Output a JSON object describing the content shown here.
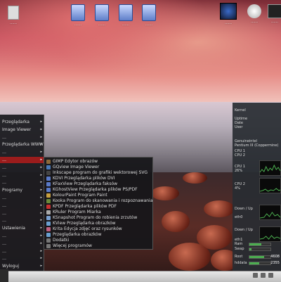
{
  "desktop_icons": [
    {
      "name": "file-icon-top-left",
      "label": "……"
    },
    {
      "name": "folder-1",
      "label": "……"
    },
    {
      "name": "folder-2",
      "label": "……"
    },
    {
      "name": "folder-3",
      "label": "……"
    },
    {
      "name": "folder-4",
      "label": "……"
    },
    {
      "name": "app-icon-1",
      "label": "……"
    },
    {
      "name": "app-icon-2",
      "label": "……"
    },
    {
      "name": "app-icon-3",
      "label": "……"
    }
  ],
  "monitor": {
    "kernel_label": "Kernel",
    "uptime_label": "Uptime",
    "date_label": "Date",
    "user_label": "User",
    "cpu_model_label": "Genuineintel",
    "cpu_model_value": "Pentium III (Coppermine)",
    "cpu1_label": "CPU 1",
    "cpu2_label": "CPU 2",
    "cpu1_pct": "26%",
    "cpu2_pct": "4%",
    "net_label": "Down / Up",
    "if1": "eth0",
    "if2": "eth1",
    "ram_label": "Ram",
    "swap_label": "Swap",
    "root_label": "Root",
    "hdd_label": "hddata",
    "ram_value": "",
    "swap_value": "",
    "root_value": "4608",
    "hdd_value": "2355",
    "ram_fill": 0.55,
    "swap_fill": 0.1,
    "root_fill": 0.7,
    "hdd_fill": 0.45
  },
  "left_menu": [
    {
      "label": "Przeglądarka"
    },
    {
      "label": "Image Viewer"
    },
    {
      "label": "…"
    },
    {
      "label": "Przeglądarka WWW"
    },
    {
      "label": "…"
    },
    {
      "label": "…",
      "active": true
    },
    {
      "label": "…"
    },
    {
      "label": "…"
    },
    {
      "label": "…"
    },
    {
      "label": "Programy"
    },
    {
      "label": "…"
    },
    {
      "label": "…"
    },
    {
      "label": "…"
    },
    {
      "label": "…"
    },
    {
      "label": "Ustawienia"
    },
    {
      "label": "…"
    },
    {
      "label": "…"
    },
    {
      "label": "…"
    },
    {
      "label": "…"
    },
    {
      "label": "Wyloguj"
    }
  ],
  "submenu": [
    {
      "label": "GIMP Edytor obrazów",
      "color": "#8b6a3a"
    },
    {
      "label": "GQview Image Viewer",
      "color": "#4a7ab8"
    },
    {
      "label": "Inkscape program do grafiki wektorowej SVG",
      "color": "#444"
    },
    {
      "label": "KDVI Przeglądarka plików DVI",
      "color": "#5a7ac8"
    },
    {
      "label": "KFaxView Przeglądarka faksów",
      "color": "#5a7ac8"
    },
    {
      "label": "KGhostView Przeglądarka plików PS/PDF",
      "color": "#5a7ac8"
    },
    {
      "label": "KolourPaint Program Paint",
      "color": "#c8a040"
    },
    {
      "label": "Kooka Program do skanowania i rozpoznawania pisma",
      "color": "#6a8a3a"
    },
    {
      "label": "KPDF Przeglądarka plików PDF",
      "color": "#c83030"
    },
    {
      "label": "KRuler Program Miarka",
      "color": "#aaa"
    },
    {
      "label": "KSnapshot Program do robienia zrzutów",
      "color": "#7aa0d0"
    },
    {
      "label": "KView Przeglądarka obrazków",
      "color": "#6aa0d0"
    },
    {
      "label": "Krita Edycja zdjęć oraz rysunków",
      "color": "#c06080"
    },
    {
      "label": "Przeglądarka obrazków",
      "color": "#6aa0d0"
    },
    {
      "label": "Dodatki",
      "color": "#777"
    },
    {
      "label": "Więcej programów",
      "color": "#777"
    }
  ]
}
